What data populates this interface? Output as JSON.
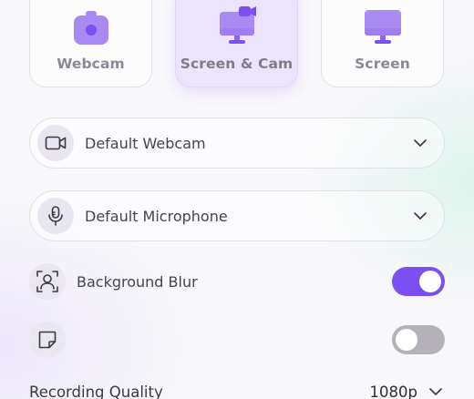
{
  "sources": [
    {
      "label": "Webcam",
      "icon": "camera-icon",
      "selected": false
    },
    {
      "label": "Screen & Cam",
      "icon": "screen-cam-icon",
      "selected": true
    },
    {
      "label": "Screen",
      "icon": "monitor-icon",
      "selected": false
    }
  ],
  "camera_select": {
    "value": "Default Webcam",
    "icon": "video-camera-icon"
  },
  "mic_select": {
    "value": "Default Microphone",
    "icon": "microphone-icon"
  },
  "background_blur": {
    "label": "Background Blur",
    "icon": "portrait-icon",
    "enabled": true
  },
  "notes": {
    "label": "",
    "icon": "note-icon",
    "enabled": false
  },
  "quality": {
    "label": "Recording Quality",
    "value": "1080p"
  },
  "colors": {
    "accent": "#7c4ff0",
    "accent_light": "#a98af2",
    "toggle_off": "#b4b2b8"
  }
}
